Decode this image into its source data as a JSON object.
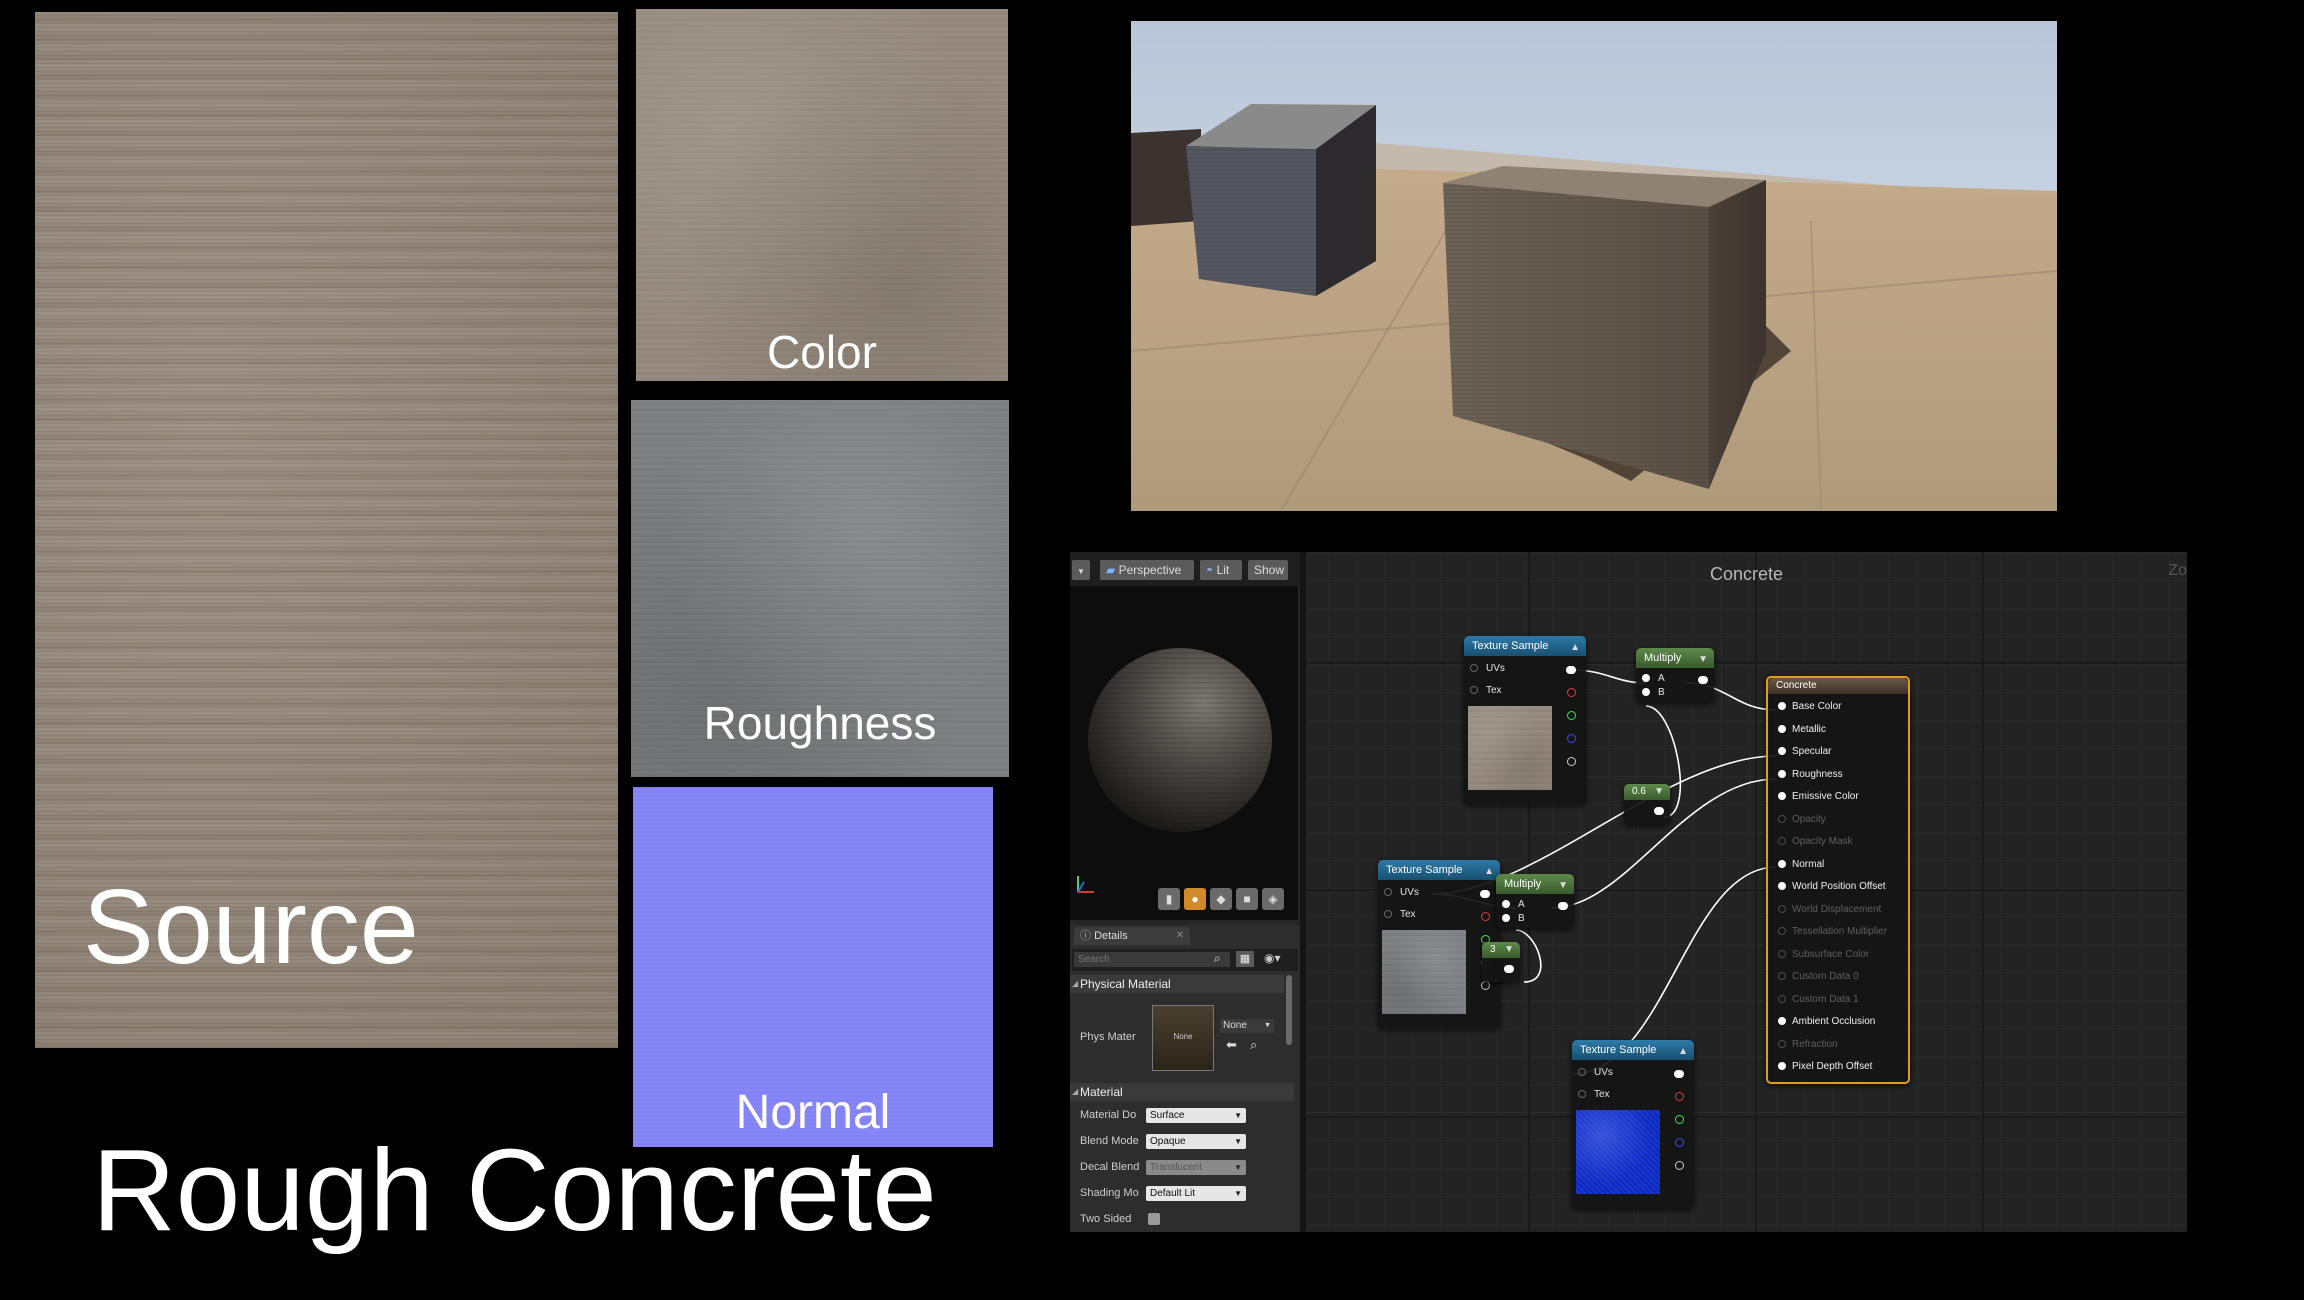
{
  "textures": {
    "source_label": "Source",
    "color_label": "Color",
    "roughness_label": "Roughness",
    "normal_label": "Normal"
  },
  "title": "Rough Concrete",
  "colors": {
    "concrete": "#928577",
    "normal_map": "#8484f8",
    "sky": "#c7d4e4",
    "accent_result_node": "#e59a1b",
    "wire": "#ffffff"
  },
  "preview_toolbar": {
    "dropdown_icon": "chevron-down-icon",
    "perspective_label": "Perspective",
    "lit_label": "Lit",
    "show_label": "Show"
  },
  "graph": {
    "title": "Concrete",
    "zoom_label": "Zo",
    "nodes": {
      "texture_sample_1": {
        "title": "Texture Sample",
        "pins": [
          "UVs",
          "Tex"
        ]
      },
      "texture_sample_2": {
        "title": "Texture Sample",
        "pins": [
          "UVs",
          "Tex"
        ]
      },
      "texture_sample_3": {
        "title": "Texture Sample",
        "pins": [
          "UVs",
          "Tex"
        ]
      },
      "multiply_1": {
        "title": "Multiply",
        "pins": [
          "A",
          "B"
        ]
      },
      "multiply_2": {
        "title": "Multiply",
        "pins": [
          "A",
          "B"
        ]
      },
      "const_1": {
        "value": "0.6"
      },
      "const_2": {
        "value": "3"
      },
      "result": {
        "title": "Concrete",
        "pins": [
          {
            "label": "Base Color",
            "active": true
          },
          {
            "label": "Metallic",
            "active": true
          },
          {
            "label": "Specular",
            "active": true
          },
          {
            "label": "Roughness",
            "active": true
          },
          {
            "label": "Emissive Color",
            "active": true
          },
          {
            "label": "Opacity",
            "active": false
          },
          {
            "label": "Opacity Mask",
            "active": false
          },
          {
            "label": "Normal",
            "active": true
          },
          {
            "label": "World Position Offset",
            "active": true
          },
          {
            "label": "World Displacement",
            "active": false
          },
          {
            "label": "Tessellation Multiplier",
            "active": false
          },
          {
            "label": "Subsurface Color",
            "active": false
          },
          {
            "label": "Custom Data 0",
            "active": false
          },
          {
            "label": "Custom Data 1",
            "active": false
          },
          {
            "label": "Ambient Occlusion",
            "active": true
          },
          {
            "label": "Refraction",
            "active": false
          },
          {
            "label": "Pixel Depth Offset",
            "active": true
          }
        ]
      }
    }
  },
  "details": {
    "tab_label": "Details",
    "search_placeholder": "Search",
    "physical_material_header": "Physical Material",
    "phys_mat_label": "Phys Mater",
    "phys_mat_thumb": "None",
    "phys_mat_value": "None",
    "material_header": "Material",
    "rows": [
      {
        "label": "Material Do",
        "value": "Surface",
        "enabled": true
      },
      {
        "label": "Blend Mode",
        "value": "Opaque",
        "enabled": true
      },
      {
        "label": "Decal Blend",
        "value": "Translucent",
        "enabled": false
      },
      {
        "label": "Shading Mo",
        "value": "Default Lit",
        "enabled": true
      }
    ],
    "two_sided_label": "Two Sided"
  }
}
